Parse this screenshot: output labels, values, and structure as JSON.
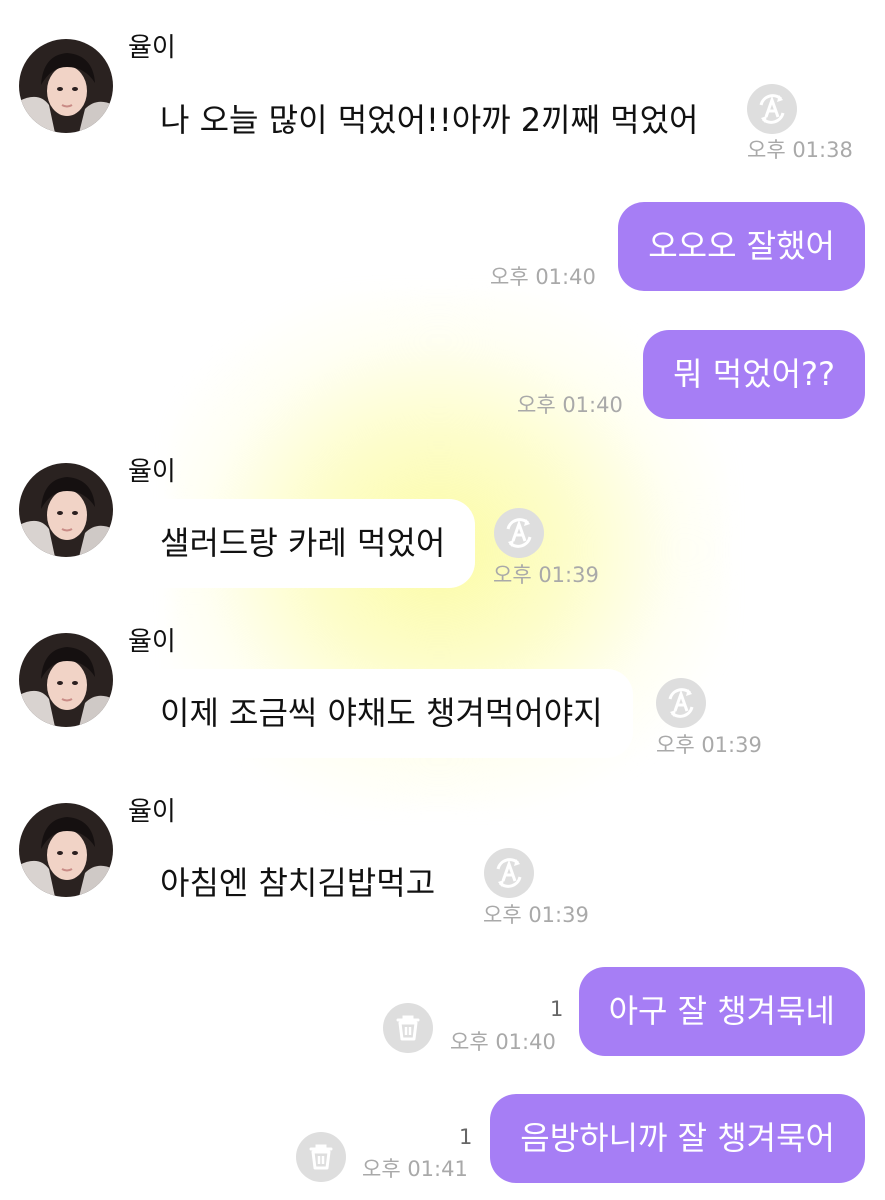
{
  "colors": {
    "outgoing_bubble": "#a67ef5",
    "incoming_bubble": "#ffffff",
    "timestamp": "#a9a9a9",
    "icon_circle": "#dedede",
    "background_glow": "#fcfca0"
  },
  "icons": {
    "avatar": "profile-photo-icon",
    "translate": "translate-icon",
    "delete": "trash-icon"
  },
  "messages": [
    {
      "direction": "incoming",
      "sender": "율이",
      "text": "나 오늘 많이 먹었어!!아까 2끼째 먹었어",
      "time": "오후 01:38"
    },
    {
      "direction": "outgoing",
      "text": "오오오 잘했어",
      "time": "오후 01:40"
    },
    {
      "direction": "outgoing",
      "text": "뭐 먹었어??",
      "time": "오후 01:40"
    },
    {
      "direction": "incoming",
      "sender": "율이",
      "text": "샐러드랑 카레 먹었어",
      "time": "오후 01:39"
    },
    {
      "direction": "incoming",
      "sender": "율이",
      "text": "이제 조금씩 야채도 챙겨먹어야지",
      "time": "오후 01:39"
    },
    {
      "direction": "incoming",
      "sender": "율이",
      "text": "아침엔 참치김밥먹고",
      "time": "오후 01:39"
    },
    {
      "direction": "outgoing",
      "text": "아구 잘 챙겨묵네",
      "time": "오후 01:40",
      "unread": "1"
    },
    {
      "direction": "outgoing",
      "text": "음방하니까 잘 챙겨묵어",
      "time": "오후 01:41",
      "unread": "1"
    }
  ]
}
